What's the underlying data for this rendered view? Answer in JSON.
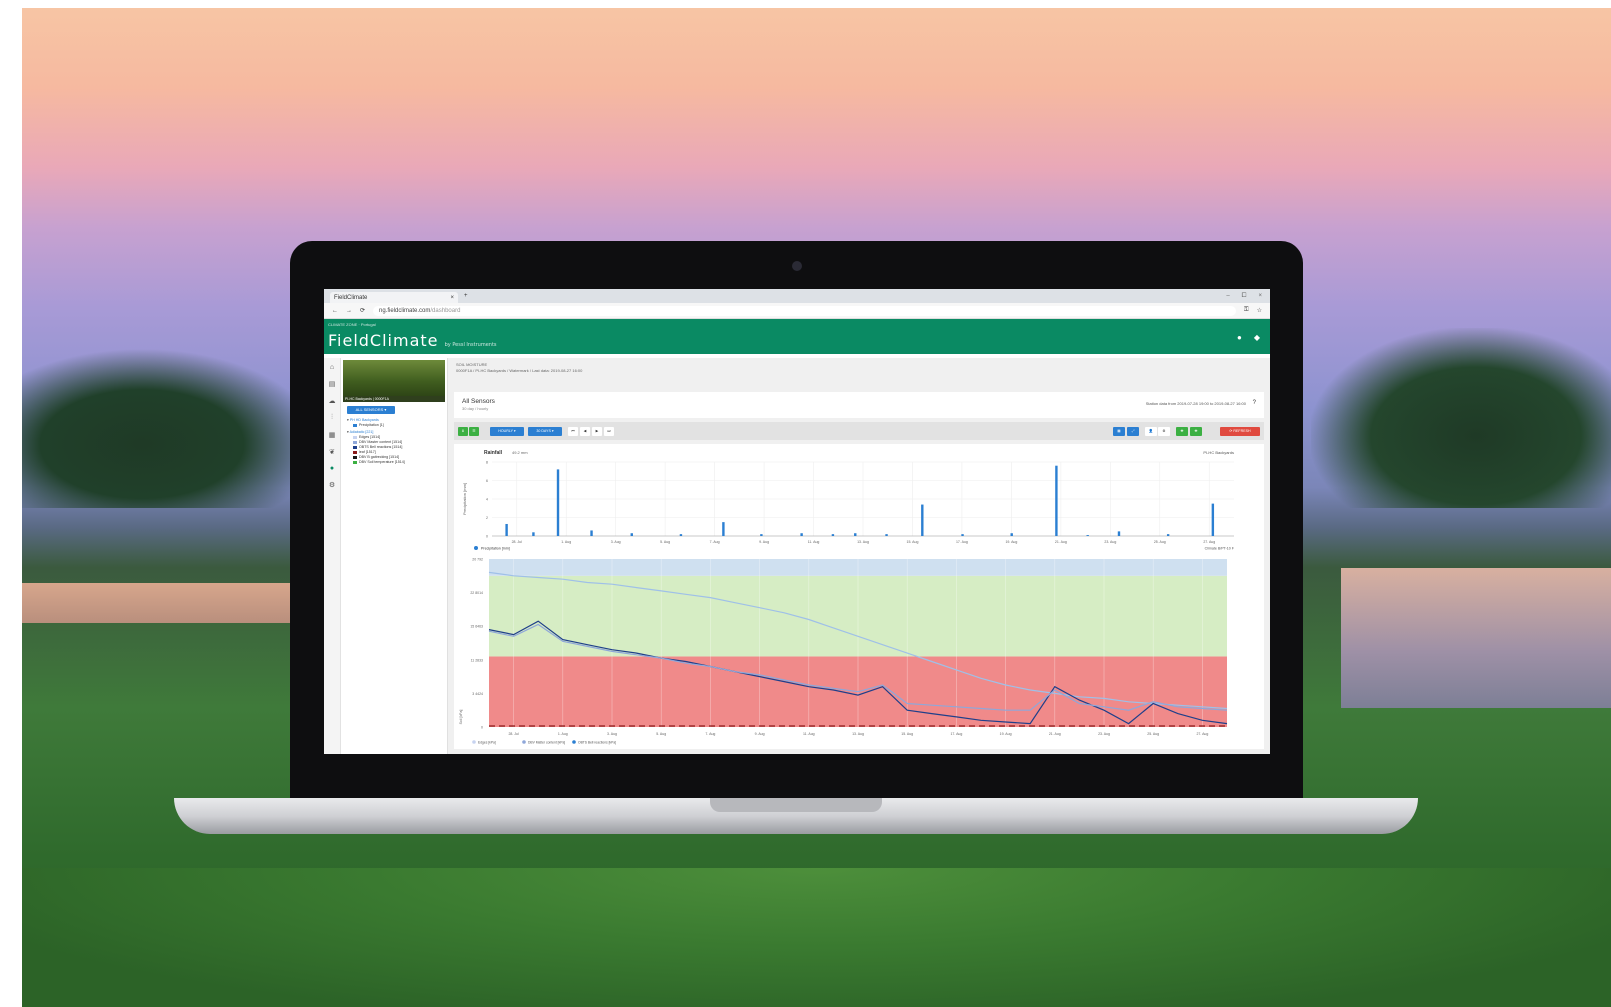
{
  "browser": {
    "tab_title": "FieldClimate",
    "tab_close": "×",
    "new_tab": "+",
    "window_controls": [
      "–",
      "⧠",
      "×"
    ],
    "url_host": "ng.fieldclimate.com",
    "url_path": "/dashboard"
  },
  "app": {
    "brand_top": "CLIMATE ZONE · Portugal",
    "brand": "FieldClimate",
    "brand_suffix": "by Pessl Instruments",
    "user_icon": "user-icon",
    "station_icon": "car-icon"
  },
  "sidebar": {
    "station_name": "PI-HC Backyards | 0000F1A",
    "all_sensors_button": "ALL SENSORS ▾",
    "groups": [
      {
        "label": "PH HD Backyards",
        "items": [
          {
            "label": "Precipitation [1]",
            "color": "#2b7fd2"
          }
        ]
      },
      {
        "label": "Adiabatic [221]",
        "items": [
          {
            "label": "Edges [1514]",
            "color": "#c7d3f0"
          },
          {
            "label": "DBV Master content [1514]",
            "color": "#8fa7d9"
          },
          {
            "label": "OBTS Bell reactions [1514]",
            "color": "#1f3f8a"
          },
          {
            "label": "leaf [1517]",
            "color": "#8b1a1a"
          },
          {
            "label": "DBV B gaitrecking [1514]",
            "color": "#1a1a1a"
          },
          {
            "label": "DBV Soil temperature [1514]",
            "color": "#3cb043"
          }
        ]
      }
    ]
  },
  "main": {
    "breadcrumb_title": "SOIL MOISTURE",
    "breadcrumb_sub": "0000F1A / PI-HC Backyards / Watermark / Last data: 2019-08-27 16:00",
    "card_title": "All Sensors",
    "card_subtitle": "30 day / hourly",
    "station_range": "Station data from 2019-07-28 19:00 to 2019-08-27 16:00",
    "help_icon": "?",
    "toolbar": {
      "btn_export": "⬇",
      "btn_table": "☰",
      "btn_hourly": "HOURLY ▾",
      "btn_30days": "30 DAYS ▾",
      "nav": [
        "⏮",
        "◀",
        "▶",
        "⏭"
      ],
      "btn_grid": "▦",
      "btn_chart": "⤢",
      "btn_user": "👤",
      "btn_settings": "⚙",
      "btn_xls": "✚",
      "btn_pdf": "✚",
      "btn_refresh": "⟳ REFRESH"
    }
  },
  "chart_data": [
    {
      "type": "bar",
      "title": "Rainfall",
      "title_value": "49.2 mm",
      "station_label": "PI-HC Backyards",
      "ylabel": "Precipitation [mm]",
      "ylim": [
        0,
        8
      ],
      "yticks": [
        "8",
        "6",
        "4",
        "2",
        "0"
      ],
      "categories": [
        "28. Jul",
        "1. Aug",
        "3. Aug",
        "5. Aug",
        "7. Aug",
        "9. Aug",
        "11. Aug",
        "13. Aug",
        "15. Aug",
        "17. Aug",
        "19. Aug",
        "21. Aug",
        "23. Aug",
        "25. Aug",
        "27. Aug"
      ],
      "values": [
        1.3,
        0.4,
        7.2,
        0.6,
        0.3,
        0.2,
        1.5,
        0.2,
        0.3,
        0.2,
        0.3,
        0.2,
        3.4,
        0.2,
        0.3,
        7.6,
        0.1,
        0.5,
        0.2,
        3.5
      ],
      "value_positions": [
        0.3,
        0.9,
        1.45,
        2.2,
        3.1,
        4.2,
        5.15,
        6.0,
        6.9,
        7.6,
        8.1,
        8.8,
        9.6,
        10.5,
        11.6,
        12.6,
        13.3,
        14.0,
        15.1,
        16.1
      ],
      "legend": "Precipitation [mm]"
    },
    {
      "type": "line",
      "legend_right": "Climate B/PT-10 F",
      "ylabel": "Soil [kPa]",
      "yticks": [
        "20 792",
        "22 8014",
        "15 6463",
        "11 2833",
        "3 4424",
        "0"
      ],
      "ylim": [
        0,
        100
      ],
      "bands": [
        {
          "from": 0,
          "to": 42,
          "color": "#f08a8a"
        },
        {
          "from": 42,
          "to": 90,
          "color": "#d6edc4"
        },
        {
          "from": 90,
          "to": 100,
          "color": "#cfe0f0"
        }
      ],
      "x": [
        0,
        1,
        2,
        3,
        4,
        5,
        6,
        7,
        8,
        9,
        10,
        11,
        12,
        13,
        14,
        15,
        16,
        17,
        18,
        19,
        20,
        21,
        22,
        23,
        24,
        25,
        26,
        27,
        28,
        29,
        30
      ],
      "series": [
        {
          "color": "#9fc0e8",
          "values": [
            92,
            90,
            89,
            88,
            86,
            85,
            83,
            81,
            79,
            77,
            74,
            71,
            68,
            64,
            59,
            54,
            49,
            44,
            39,
            34,
            29,
            25,
            22,
            20,
            18,
            17,
            15,
            14,
            13,
            12,
            11
          ]
        },
        {
          "color": "#1f3f8a",
          "values": [
            58,
            55,
            63,
            52,
            49,
            46,
            44,
            41,
            39,
            36,
            33,
            30,
            27,
            24,
            22,
            19,
            24,
            10,
            8,
            6,
            4,
            3,
            2,
            24,
            16,
            10,
            2,
            14,
            8,
            4,
            2
          ]
        },
        {
          "color": "#8fa7d9",
          "values": [
            57,
            54,
            61,
            51,
            48,
            45,
            43,
            41,
            38,
            36,
            33,
            31,
            28,
            25,
            23,
            21,
            25,
            14,
            13,
            12,
            11,
            10,
            10,
            22,
            14,
            12,
            10,
            15,
            12,
            11,
            10
          ]
        }
      ],
      "legend": [
        "Edges [kPa]",
        "DBV Matter content [kPa]",
        "OBTS Bell reactions [kPa]"
      ]
    }
  ]
}
